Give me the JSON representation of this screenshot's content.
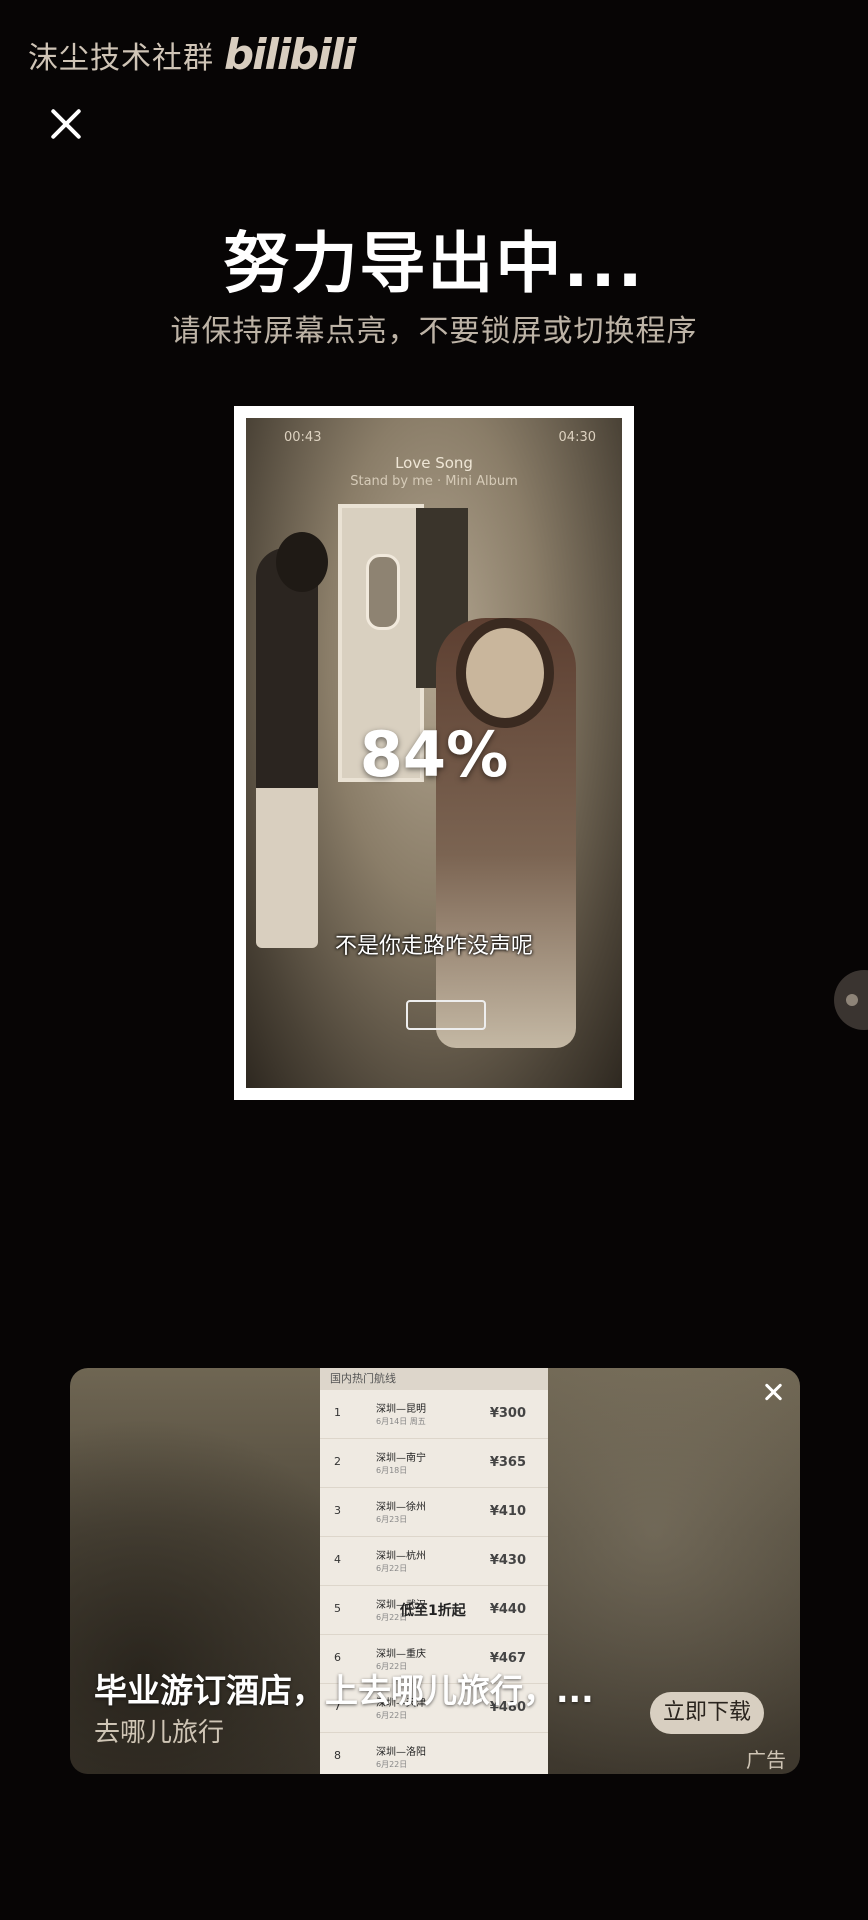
{
  "watermark": {
    "text": "沫尘技术社群",
    "logo": "bilibili"
  },
  "close_label": "close",
  "export": {
    "title": "努力导出中...",
    "subtitle": "请保持屏幕点亮，不要锁屏或切换程序",
    "progress_text": "84%",
    "progress": 0.84
  },
  "preview": {
    "time_left": "00:43",
    "time_right": "04:30",
    "song": "Love Song",
    "album": "Stand by me · Mini Album",
    "subtitle": "不是你走路咋没声呢"
  },
  "ad": {
    "list_header": "国内热门航线",
    "routes": [
      {
        "rank": "1",
        "name": "深圳—昆明",
        "date": "6月14日 周五",
        "price": "¥300"
      },
      {
        "rank": "2",
        "name": "深圳—南宁",
        "date": "6月18日",
        "price": "¥365"
      },
      {
        "rank": "3",
        "name": "深圳—徐州",
        "date": "6月23日",
        "price": "¥410"
      },
      {
        "rank": "4",
        "name": "深圳—杭州",
        "date": "6月22日",
        "price": "¥430"
      },
      {
        "rank": "5",
        "name": "深圳—武汉",
        "date": "6月22日",
        "price": "¥440"
      },
      {
        "rank": "6",
        "name": "深圳—重庆",
        "date": "6月22日",
        "price": "¥467"
      },
      {
        "rank": "7",
        "name": "深圳—天津",
        "date": "6月22日",
        "price": "¥480"
      },
      {
        "rank": "8",
        "name": "深圳—洛阳",
        "date": "6月22日",
        "price": ""
      }
    ],
    "promo": "低至1折起",
    "title": "毕业游订酒店，上去哪儿旅行，...",
    "brand": "去哪儿旅行",
    "download_label": "立即下载",
    "ad_label": "广告"
  },
  "colors": {
    "background": "#070505",
    "frame": "#ffffff",
    "subtitle_text": "#bdb3a6",
    "download_button": "#d8cfc1"
  },
  "icons": [
    "close-icon",
    "ad-close-icon",
    "side-handle-icon"
  ]
}
